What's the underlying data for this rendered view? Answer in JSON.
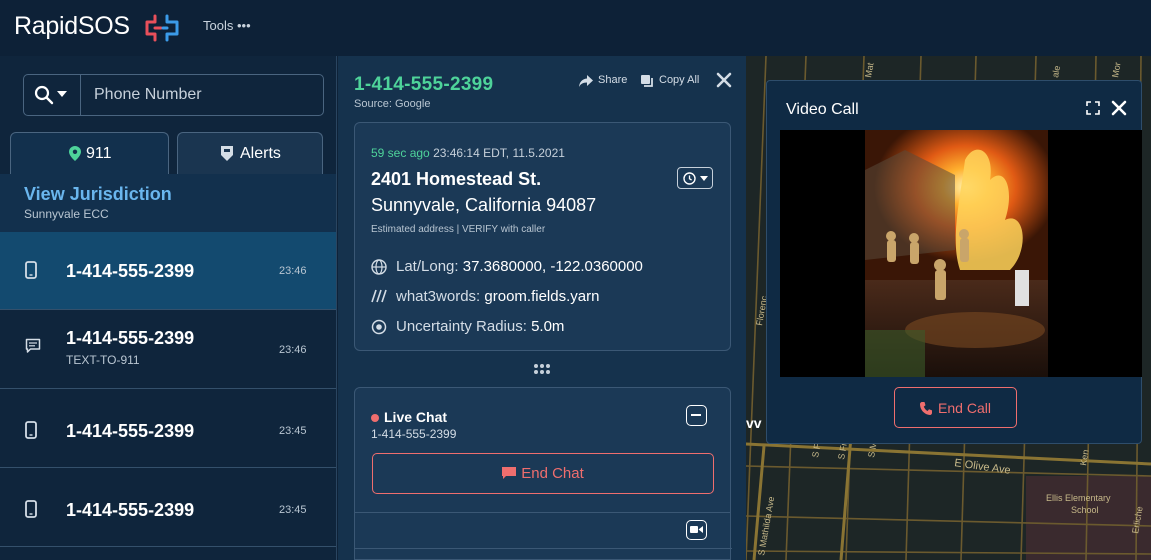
{
  "topbar": {
    "brand": "RapidSOS",
    "tools_label": "Tools •••"
  },
  "search": {
    "placeholder": "Phone Number"
  },
  "tabs": [
    {
      "label": "911",
      "active": true
    },
    {
      "label": "Alerts",
      "active": false
    }
  ],
  "jurisdiction": {
    "title": "View Jurisdiction",
    "subtitle": "Sunnyvale ECC"
  },
  "calls": [
    {
      "number": "1-414-555-2399",
      "time": "23:46",
      "type": "phone",
      "subtitle": "",
      "active": true
    },
    {
      "number": "1-414-555-2399",
      "time": "23:46",
      "type": "text",
      "subtitle": "TEXT-TO-911",
      "active": false
    },
    {
      "number": "1-414-555-2399",
      "time": "23:45",
      "type": "phone",
      "subtitle": "",
      "active": false
    },
    {
      "number": "1-414-555-2399",
      "time": "23:45",
      "type": "phone",
      "subtitle": "",
      "active": false
    }
  ],
  "detail": {
    "phone": "1-414-555-2399",
    "source": "Source: Google",
    "share_label": "Share",
    "copy_label": "Copy All",
    "location": {
      "ago": "59 sec ago",
      "timestamp": "23:46:14 EDT, 11.5.2021",
      "street": "2401 Homestead St.",
      "city": "Sunnyvale, California 94087",
      "estimate_note": "Estimated address | VERIFY with caller",
      "latlong_label": "Lat/Long:",
      "latlong_value": "37.3680000, -122.0360000",
      "w3w_label": "what3words:",
      "w3w_value": "groom.fields.yarn",
      "uncertainty_label": "Uncertainty Radius:",
      "uncertainty_value": "5.0m"
    },
    "chat": {
      "title": "Live Chat",
      "number": "1-414-555-2399",
      "end_label": "End Chat"
    }
  },
  "map": {
    "streets": [
      "E Olive Ave",
      "S Mathilda Ave",
      "S Fr",
      "S Mu",
      "S Fl",
      "Ken",
      "Florenc",
      "Ellis Elementary",
      "School",
      "Mat",
      "Mor",
      "Erliche",
      "ale",
      "vv"
    ]
  },
  "video_call": {
    "title": "Video Call",
    "end_label": "End Call"
  },
  "colors": {
    "accent_green": "#4ed39a",
    "link_blue": "#6ab6ee",
    "danger_red": "#ef6e6e",
    "panel_bg": "#0f253c",
    "active_row": "#134a6f"
  }
}
